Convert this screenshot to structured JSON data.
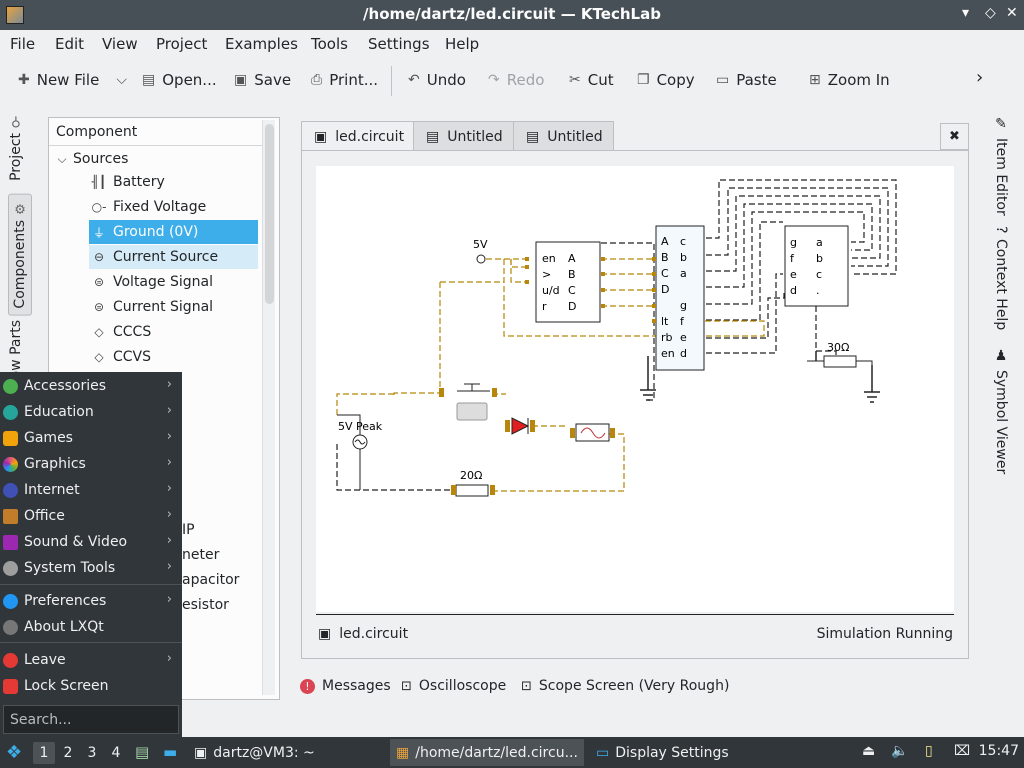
{
  "window": {
    "title": "/home/dartz/led.circuit — KTechLab",
    "buttons": [
      "▾",
      "◇",
      "✕"
    ]
  },
  "menu": [
    "File",
    "Edit",
    "View",
    "Project",
    "Examples",
    "Tools",
    "Settings",
    "Help"
  ],
  "toolbar": {
    "new_file": "New File",
    "open": "Open...",
    "save": "Save",
    "print": "Print...",
    "undo": "Undo",
    "redo": "Redo",
    "cut": "Cut",
    "copy": "Copy",
    "paste": "Paste",
    "zoom_in": "Zoom In"
  },
  "left_tabs": [
    "Project",
    "Components",
    "Low Parts"
  ],
  "component_panel": {
    "header": "Component",
    "category": "Sources",
    "items": [
      {
        "label": "Battery",
        "icon": "battery-icon"
      },
      {
        "label": "Fixed Voltage",
        "icon": "fixed-voltage-icon"
      },
      {
        "label": "Ground (0V)",
        "icon": "ground-icon",
        "selected": true
      },
      {
        "label": "Current Source",
        "icon": "current-source-icon",
        "hover": true
      },
      {
        "label": "Voltage Signal",
        "icon": "voltage-signal-icon"
      },
      {
        "label": "Current Signal",
        "icon": "current-signal-icon"
      },
      {
        "label": "CCCS",
        "icon": "cccs-icon"
      },
      {
        "label": "CCVS",
        "icon": "ccvs-icon"
      }
    ],
    "partial_items": [
      "IP",
      "neter",
      "apacitor",
      "esistor"
    ]
  },
  "doc_tabs": [
    {
      "label": "led.circuit",
      "active": true
    },
    {
      "label": "Untitled",
      "active": false
    },
    {
      "label": "Untitled",
      "active": false
    }
  ],
  "circuit": {
    "labels": {
      "v5": "5V",
      "v5peak": "5V Peak",
      "r30": "30Ω",
      "r20": "20Ω"
    },
    "chip1_left": [
      "en",
      ">",
      "u/d",
      "r"
    ],
    "chip1_right": [
      "A",
      "B",
      "C",
      "D"
    ],
    "chip2_left": [
      "A",
      "B",
      "C",
      "D",
      "",
      "lt",
      "rb",
      "en"
    ],
    "chip2_right": [
      "c",
      "b",
      "a",
      "",
      "g",
      "f",
      "e",
      "d"
    ],
    "chip3_left": [
      "g",
      "f",
      "e",
      "d"
    ],
    "chip3_right": [
      "a",
      "b",
      "c",
      "."
    ]
  },
  "status": {
    "file": "led.circuit",
    "state": "Simulation Running"
  },
  "bottom_tabs": [
    "Messages",
    "Oscilloscope",
    "Scope Screen (Very Rough)"
  ],
  "right_tabs": [
    "Item Editor",
    "Context Help",
    "Symbol Viewer"
  ],
  "start_menu": {
    "items": [
      {
        "label": "Accessories",
        "color": "#4caf50",
        "sub": true
      },
      {
        "label": "Education",
        "color": "#26a69a",
        "sub": true
      },
      {
        "label": "Games",
        "color": "#f0a30a",
        "sub": true
      },
      {
        "label": "Graphics",
        "color": "#e05a7a",
        "sub": true
      },
      {
        "label": "Internet",
        "color": "#3f51b5",
        "sub": true
      },
      {
        "label": "Office",
        "color": "#c17d2a",
        "sub": true
      },
      {
        "label": "Sound & Video",
        "color": "#9c27b0",
        "sub": true
      },
      {
        "label": "System Tools",
        "color": "#9e9e9e",
        "sub": true
      }
    ],
    "items2": [
      {
        "label": "Preferences",
        "color": "#2196f3",
        "sub": true
      },
      {
        "label": "About LXQt",
        "color": "#777777",
        "sub": false
      }
    ],
    "items3": [
      {
        "label": "Leave",
        "color": "#e53935",
        "sub": true
      },
      {
        "label": "Lock Screen",
        "color": "#e53935",
        "sub": false
      }
    ],
    "search_placeholder": "Search..."
  },
  "taskbar": {
    "desktops": [
      "1",
      "2",
      "3",
      "4"
    ],
    "tasks": [
      "dartz@VM3: ~",
      "/home/dartz/led.circu...",
      "Display Settings"
    ],
    "clock": "15:47"
  }
}
